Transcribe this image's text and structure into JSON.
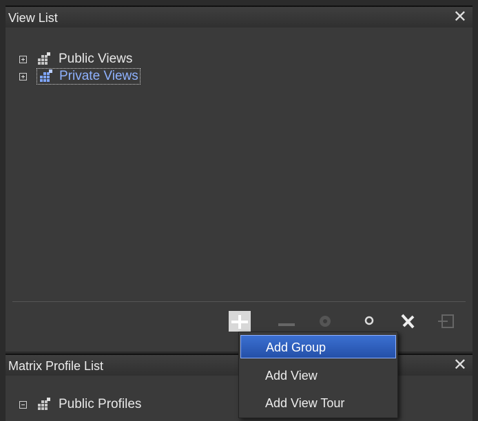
{
  "view_list": {
    "title": "View List",
    "items": [
      {
        "label": "Public Views",
        "expanded": false
      },
      {
        "label": "Private Views",
        "expanded": false,
        "selected": true
      }
    ],
    "toolbar": {
      "buttons": [
        "plus-icon",
        "minus-icon",
        "gear-icon",
        "search-icon",
        "wrench-icon",
        "export-icon"
      ]
    }
  },
  "matrix_profile_list": {
    "title": "Matrix Profile List",
    "items": [
      {
        "label": "Public Profiles",
        "expanded": true
      }
    ]
  },
  "context_menu": {
    "items": [
      "Add Group",
      "Add View",
      "Add View Tour"
    ],
    "highlighted_index": 0
  },
  "colors": {
    "background": "#2b2b2b",
    "panel": "#3a3a3a",
    "selected_text": "#8fb2ff",
    "menu_highlight": "#2f5fc4"
  }
}
